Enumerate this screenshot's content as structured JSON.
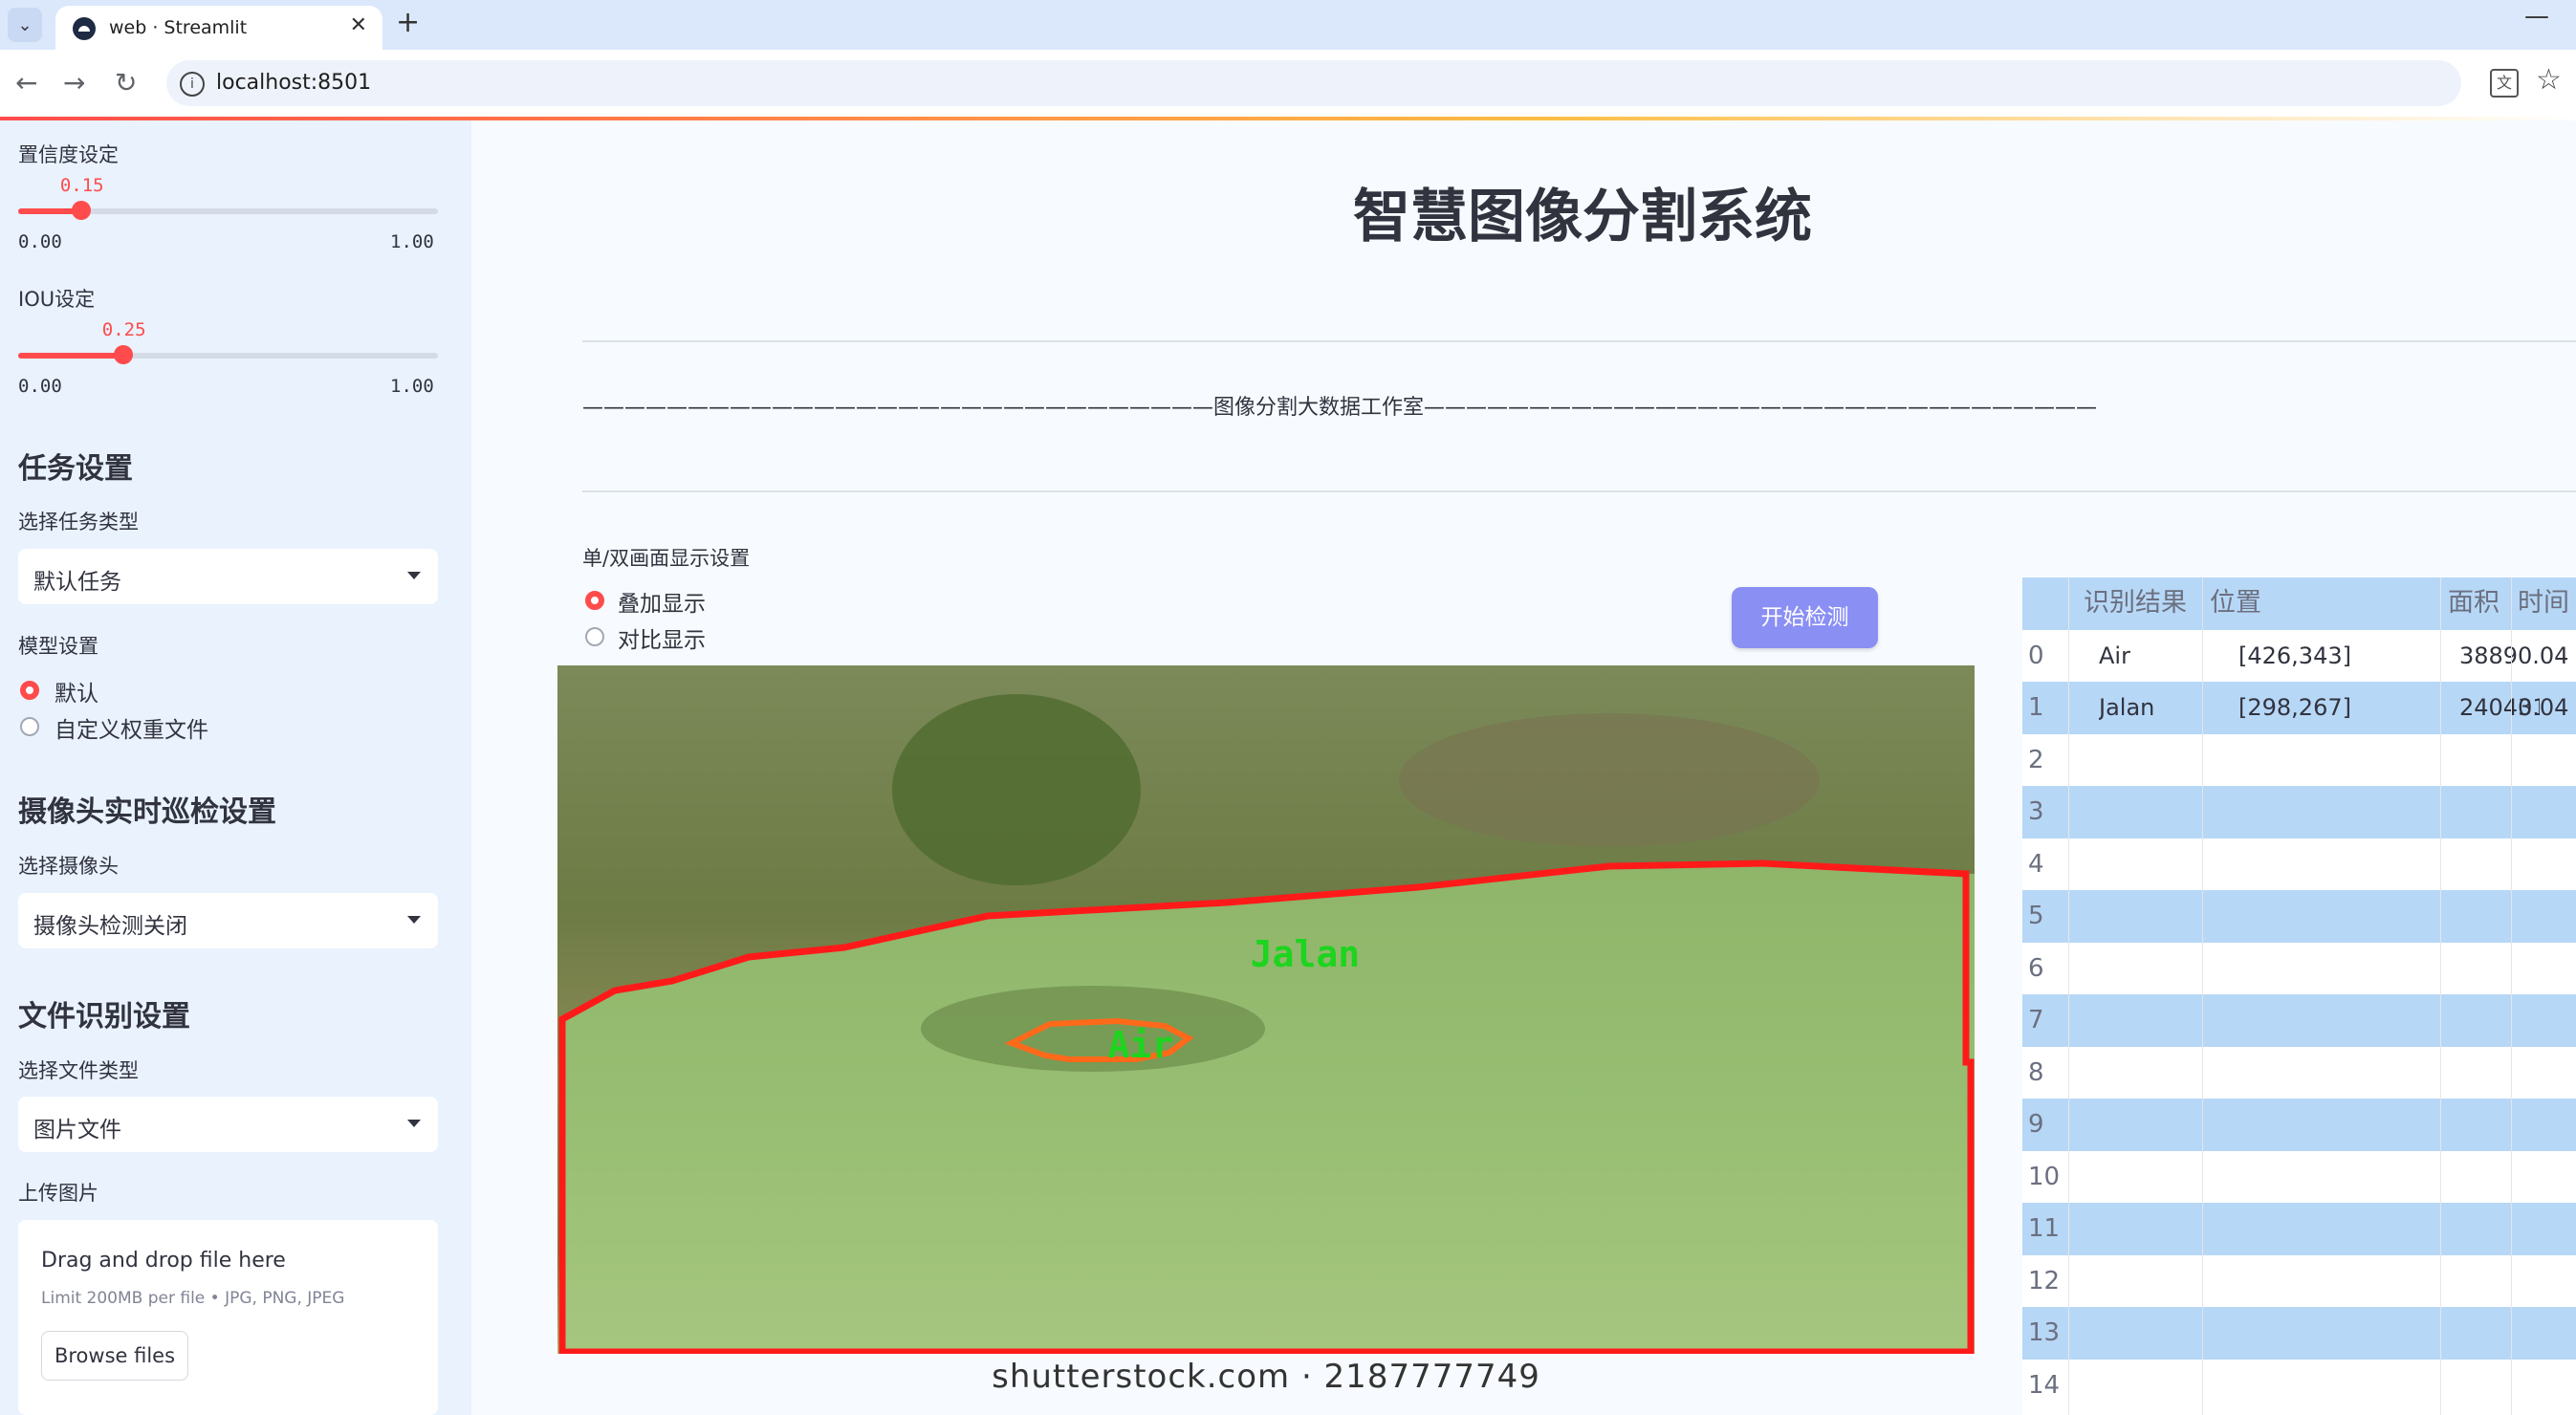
{
  "browser": {
    "tab_title": "web · Streamlit",
    "tab_close": "✕",
    "new_tab": "+",
    "url": "localhost:8501",
    "minimize": "—"
  },
  "sidebar": {
    "confidence": {
      "label": "置信度设定",
      "value": "0.15",
      "value_fraction": 0.15,
      "min": "0.00",
      "max": "1.00"
    },
    "iou": {
      "label": "IOU设定",
      "value": "0.25",
      "value_fraction": 0.25,
      "min": "0.00",
      "max": "1.00"
    },
    "task_section": {
      "heading": "任务设置",
      "select_label": "选择任务类型",
      "selected": "默认任务"
    },
    "model_section": {
      "label": "模型设置",
      "options": [
        "默认",
        "自定义权重文件"
      ],
      "selected_index": 0
    },
    "camera_section": {
      "heading": "摄像头实时巡检设置",
      "select_label": "选择摄像头",
      "selected": "摄像头检测关闭"
    },
    "file_section": {
      "heading": "文件识别设置",
      "select_label": "选择文件类型",
      "selected": "图片文件"
    },
    "upload": {
      "label": "上传图片",
      "drop_text": "Drag and drop file here",
      "limit_text": "Limit 200MB per file • JPG, PNG, JPEG",
      "browse_label": "Browse files"
    }
  },
  "main": {
    "title": "智慧图像分割系统",
    "studio_line": "——————————————————————————————图像分割大数据工作室————————————————————————————————",
    "display_label": "单/双画面显示设置",
    "display_options": [
      "叠加显示",
      "对比显示"
    ],
    "display_selected_index": 0,
    "detect_button": "开始检测",
    "image": {
      "labels": [
        "Jalan",
        "Air"
      ],
      "watermark": "shutterstock.com · 2187777749",
      "colors": {
        "jalan": "#ff1a1a",
        "air": "#ff6a1a",
        "label_text": "#1ed41e"
      }
    }
  },
  "table": {
    "columns": [
      "",
      "识别结果",
      "位置",
      "面积",
      "时间"
    ],
    "rows": [
      [
        "0",
        "Air",
        "[426,343]",
        "3889",
        "0.04"
      ],
      [
        "1",
        "Jalan",
        "[298,267]",
        "240431",
        "0.04"
      ],
      [
        "2",
        "",
        "",
        "",
        ""
      ],
      [
        "3",
        "",
        "",
        "",
        ""
      ],
      [
        "4",
        "",
        "",
        "",
        ""
      ],
      [
        "5",
        "",
        "",
        "",
        ""
      ],
      [
        "6",
        "",
        "",
        "",
        ""
      ],
      [
        "7",
        "",
        "",
        "",
        ""
      ],
      [
        "8",
        "",
        "",
        "",
        ""
      ],
      [
        "9",
        "",
        "",
        "",
        ""
      ],
      [
        "10",
        "",
        "",
        "",
        ""
      ],
      [
        "11",
        "",
        "",
        "",
        ""
      ],
      [
        "12",
        "",
        "",
        "",
        ""
      ],
      [
        "13",
        "",
        "",
        "",
        ""
      ],
      [
        "14",
        "",
        "",
        "",
        ""
      ]
    ]
  },
  "colors": {
    "accent": "#ff4b4b",
    "button": "#8a8ff4",
    "sidebar_bg": "#e9f2fd",
    "table_stripe": "#b7d7f6"
  }
}
